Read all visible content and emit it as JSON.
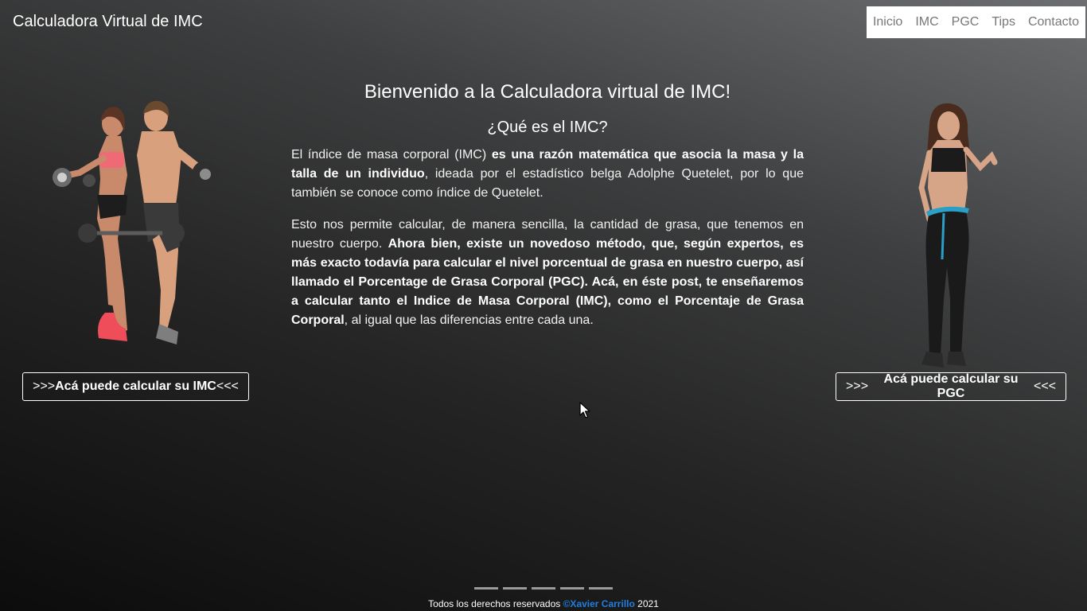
{
  "header": {
    "brand": "Calculadora Virtual de IMC",
    "nav": [
      "Inicio",
      "IMC",
      "PGC",
      "Tips",
      "Contacto"
    ]
  },
  "main": {
    "title": "Bienvenido a la Calculadora virtual de IMC!",
    "subtitle": "¿Qué es el IMC?",
    "p1": {
      "a": "El índice de masa corporal (IMC) ",
      "b": "es una razón matemática que asocia la masa y la talla de un individuo",
      "c": ", ideada por el estadístico belga Adolphe Quetelet, por lo que también se conoce como índice de Quetelet."
    },
    "p2": {
      "a": "Esto nos permite calcular, de manera sencilla, la cantidad de grasa, que tenemos en nuestro cuerpo. ",
      "b": "Ahora bien, existe un novedoso método, que, según expertos, es más exacto todavía para calcular el nivel porcentual de grasa en nuestro cuerpo, así llamado el Porcentage de Grasa Corporal (PGC). Acá, en éste post, te enseñaremos a calcular tanto el Indice de Masa Corporal (IMC), como el Porcentaje de Grasa Corporal",
      "c": ", al igual que las diferencias entre cada una."
    }
  },
  "left_cta": {
    "arrows_left": ">>>",
    "label": "Acá puede calcular su IMC",
    "arrows_right": "<<<"
  },
  "right_cta": {
    "arrows_left": ">>>",
    "label": "Acá puede calcular su PGC",
    "arrows_right": "<<<"
  },
  "carousel": {
    "indicator_count": 5
  },
  "footer": {
    "text": "Todos los derechos reservados ",
    "author": "©Xavier Carrillo",
    "year": " 2021"
  },
  "icons": {
    "left_image": "fitness-couple-image",
    "right_image": "fitness-woman-image",
    "cursor": "mouse-pointer-icon"
  },
  "colors": {
    "author_link": "#1f7fe0",
    "nav_bg": "#ffffff",
    "nav_text": "#777777"
  }
}
